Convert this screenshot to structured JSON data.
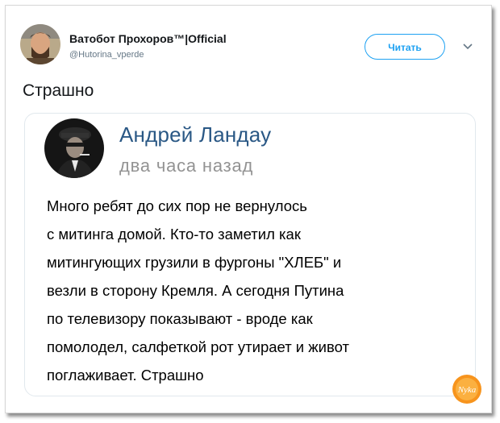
{
  "tweet": {
    "author_name": "Ватобот Прохоров™|Official",
    "author_handle": "@Hutorina_vperde",
    "follow_label": "Читать",
    "text": "Страшно"
  },
  "embedded_post": {
    "author_name": "Андрей Ландау",
    "time": "два часа назад",
    "lines": [
      "Много ребят до сих пор не вернулось",
      "с митинга домой. Кто-то заметил как",
      "митингующих грузили в фургоны \"ХЛЕБ\" и",
      "везли в сторону Кремля. А сегодня Путина",
      "по телевизору показывают - вроде как",
      "помолодел, салфеткой рот утирает и живот",
      "поглаживает. Страшно"
    ]
  },
  "watermark": {
    "text": "Nyka"
  },
  "colors": {
    "accent": "#1da1f2",
    "vk_name": "#2a5885",
    "watermark": "#f7941d"
  },
  "icons": {
    "menu": "chevron-down-icon"
  }
}
